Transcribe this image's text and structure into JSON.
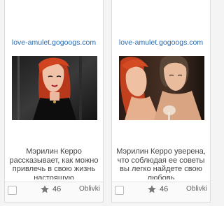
{
  "cards": [
    {
      "source": "love-amulet.gogoogs.com",
      "text": "Мэрилин Керро рассказывает, как можно привлечь в свою жизнь настоящую",
      "rating": "46",
      "brand": "Oblivki"
    },
    {
      "source": "love-amulet.gogoogs.com",
      "text": "Мэрилин Керро уверена, что соблюдая ее советы вы легко найдете свою любовь",
      "rating": "46",
      "brand": "Oblivki"
    }
  ],
  "icons": {
    "rating": "star-icon"
  },
  "colors": {
    "link": "#2a6db5",
    "text": "#444444",
    "star": "#777777"
  }
}
